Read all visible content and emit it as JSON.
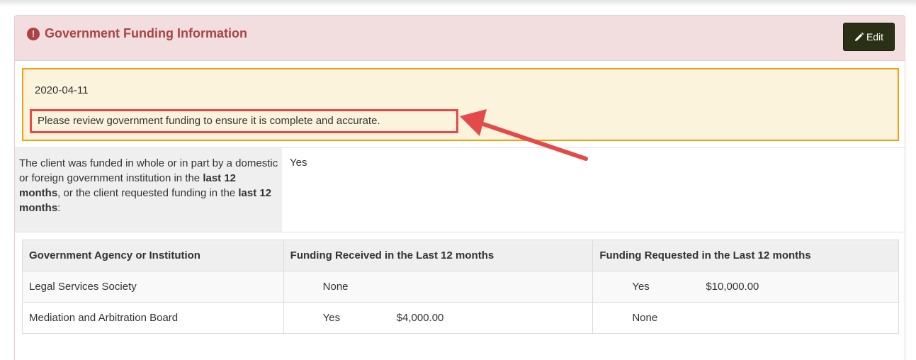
{
  "panel": {
    "title": "Government Funding Information",
    "edit_label": "Edit"
  },
  "alert": {
    "date": "2020-04-11",
    "message": "Please review government funding to ensure it is complete and accurate."
  },
  "question": {
    "text_a": "The client was funded in whole or in part by a domestic or foreign government institution in the ",
    "bold_a": "last 12 months",
    "text_b": ", or the client requested funding in the ",
    "bold_b": "last 12 months",
    "text_c": ":",
    "answer": "Yes"
  },
  "table": {
    "headers": [
      "Government Agency or Institution",
      "Funding Received in the Last 12 months",
      "Funding Requested in the Last 12 months"
    ],
    "rows": [
      {
        "agency": "Legal Services Society",
        "received": {
          "flag": "None",
          "amount": ""
        },
        "requested": {
          "flag": "Yes",
          "amount": "$10,000.00"
        }
      },
      {
        "agency": "Mediation and Arbitration Board",
        "received": {
          "flag": "Yes",
          "amount": "$4,000.00"
        },
        "requested": {
          "flag": "None",
          "amount": ""
        }
      }
    ]
  },
  "colors": {
    "heading_bg": "#f2dede",
    "heading_text": "#a94442",
    "alert_bg": "#fcf3dc",
    "alert_border": "#f0a00c",
    "highlight_border": "#e44a4a",
    "edit_button_bg": "#2a3015"
  },
  "icons": {
    "title": "exclamation-circle-icon",
    "edit": "pencil-icon",
    "annotation": "arrow-annotation"
  }
}
